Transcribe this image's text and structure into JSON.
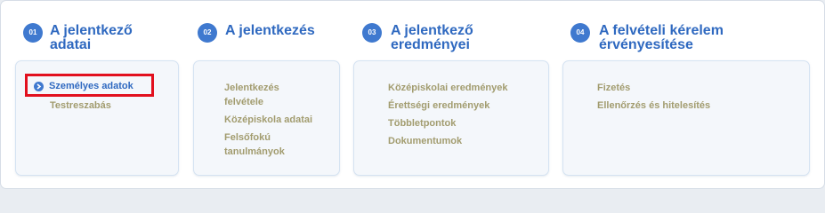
{
  "steps": [
    {
      "number": "01",
      "title_line1": "A jelentkező",
      "title_line2": "adatai",
      "links": [
        {
          "label": "Személyes adatok",
          "active": true
        },
        {
          "label": "Testreszabás"
        }
      ]
    },
    {
      "number": "02",
      "title_line1": "A jelentkezés",
      "links": [
        {
          "label_line1": "Jelentkezés",
          "label_line2": "felvétele"
        },
        {
          "label": "Középiskola adatai"
        },
        {
          "label_line1": "Felsőfokú",
          "label_line2": "tanulmányok"
        }
      ]
    },
    {
      "number": "03",
      "title_line1": "A jelentkező",
      "title_line2": "eredményei",
      "links": [
        {
          "label": "Középiskolai eredmények"
        },
        {
          "label": "Érettségi eredmények"
        },
        {
          "label": "Többletpontok"
        },
        {
          "label": "Dokumentumok"
        }
      ]
    },
    {
      "number": "04",
      "title_line1": "A felvételi kérelem",
      "title_line2": "érvényesítése",
      "links": [
        {
          "label": "Fizetés"
        },
        {
          "label": "Ellenőrzés és hitelesítés"
        }
      ]
    }
  ],
  "icons": {
    "active_link": "chevron-right-icon"
  },
  "colors": {
    "accent": "#3f79cf",
    "title": "#2f69c0",
    "link": "#a29c6f",
    "highlight": "#e2101e"
  }
}
